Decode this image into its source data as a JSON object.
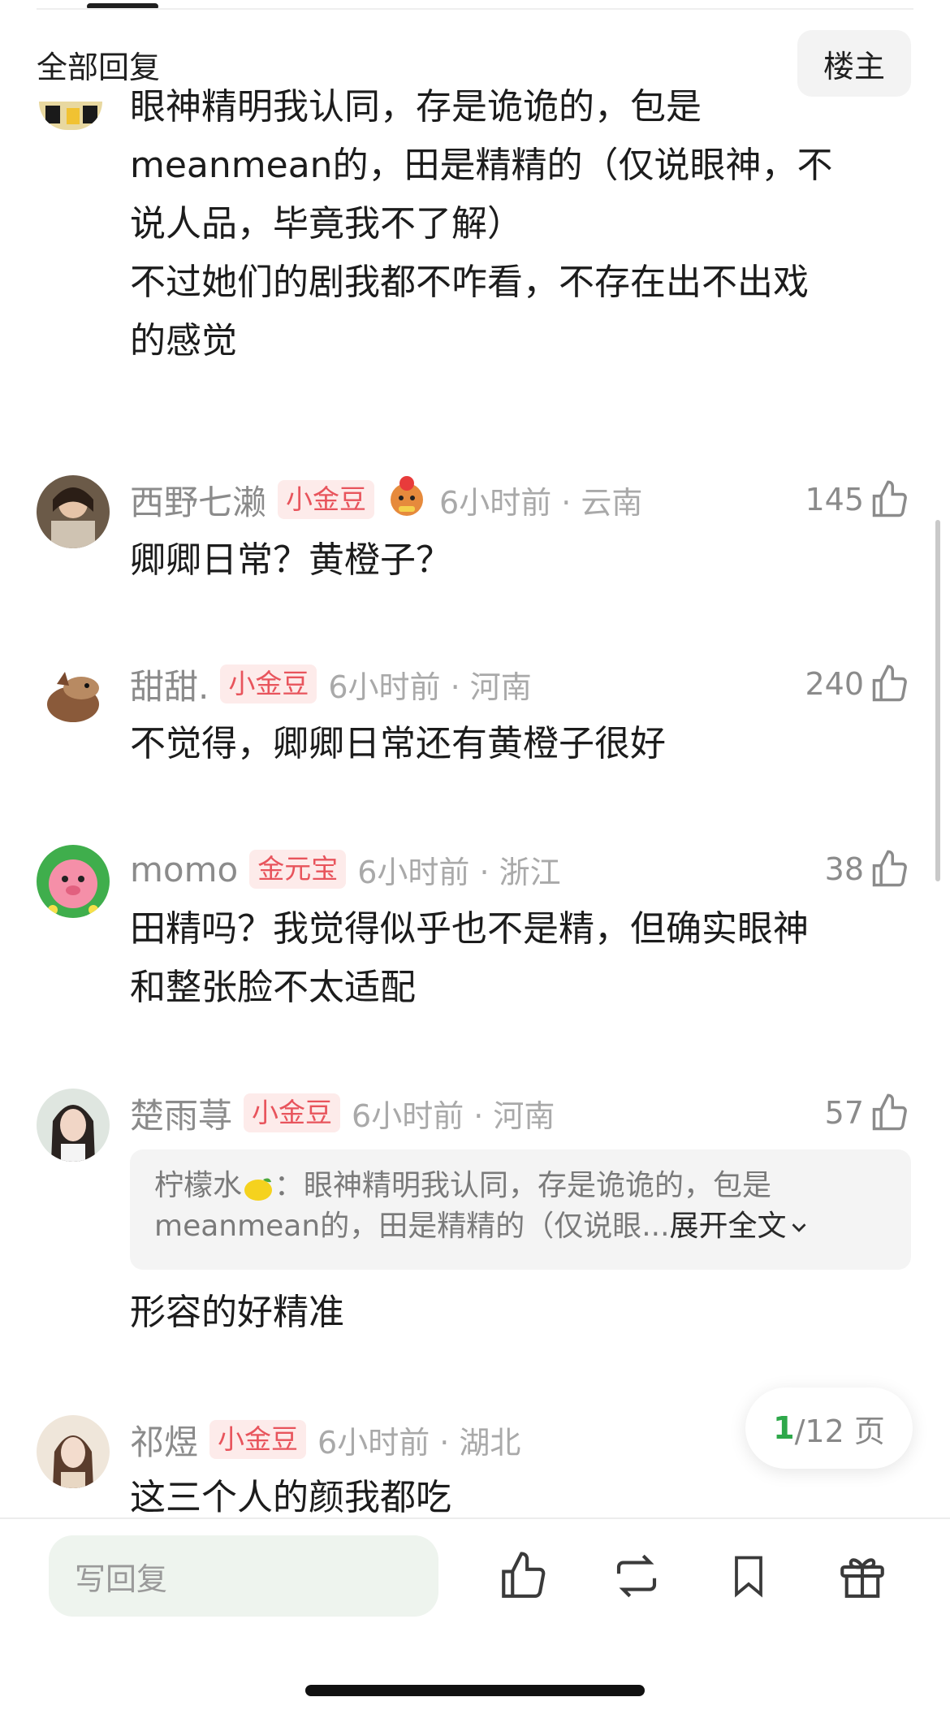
{
  "header": {
    "title": "全部回复",
    "owner_label": "楼主"
  },
  "first_comment_text": "眼神精明我认同，存是诡诡的，包是\nmeanmean的，田是精精的（仅说眼神，不\n说人品，毕竟我不了解）\n不过她们的剧我都不咋看，不存在出不出戏\n的感觉",
  "comments": [
    {
      "username": "西野七濑",
      "badge": "小金豆",
      "time": "6小时前 · 云南",
      "likes": "145",
      "text": "卿卿日常？黄橙子？"
    },
    {
      "username": "甜甜.",
      "badge": "小金豆",
      "time": "6小时前 · 河南",
      "likes": "240",
      "text": "不觉得，卿卿日常还有黄橙子很好"
    },
    {
      "username": "momo",
      "badge": "金元宝",
      "time": "6小时前 · 浙江",
      "likes": "38",
      "text": "田精吗？我觉得似乎也不是精，但确实眼神\n和整张脸不太适配"
    },
    {
      "username": "楚雨荨",
      "badge": "小金豆",
      "time": "6小时前 · 河南",
      "likes": "57",
      "text": "形容的好精准"
    },
    {
      "username": "祁煜",
      "badge": "小金豆",
      "time": "6小时前 · 湖北",
      "likes": "",
      "text": "这三个人的颜我都吃"
    }
  ],
  "quote": {
    "author": "柠檬水",
    "line1": "：眼神精明我认同，存是诡诡的，包是",
    "line2": "meanmean的，田是精精的（仅说眼...",
    "expand_label": "展开全文"
  },
  "pager": {
    "current": "1",
    "total": "/12 页"
  },
  "bottom_bar": {
    "reply_placeholder": "写回复"
  },
  "icons": [
    "thumbs-up-icon",
    "repost-icon",
    "bookmark-icon",
    "gift-icon",
    "chevron-down-icon"
  ]
}
